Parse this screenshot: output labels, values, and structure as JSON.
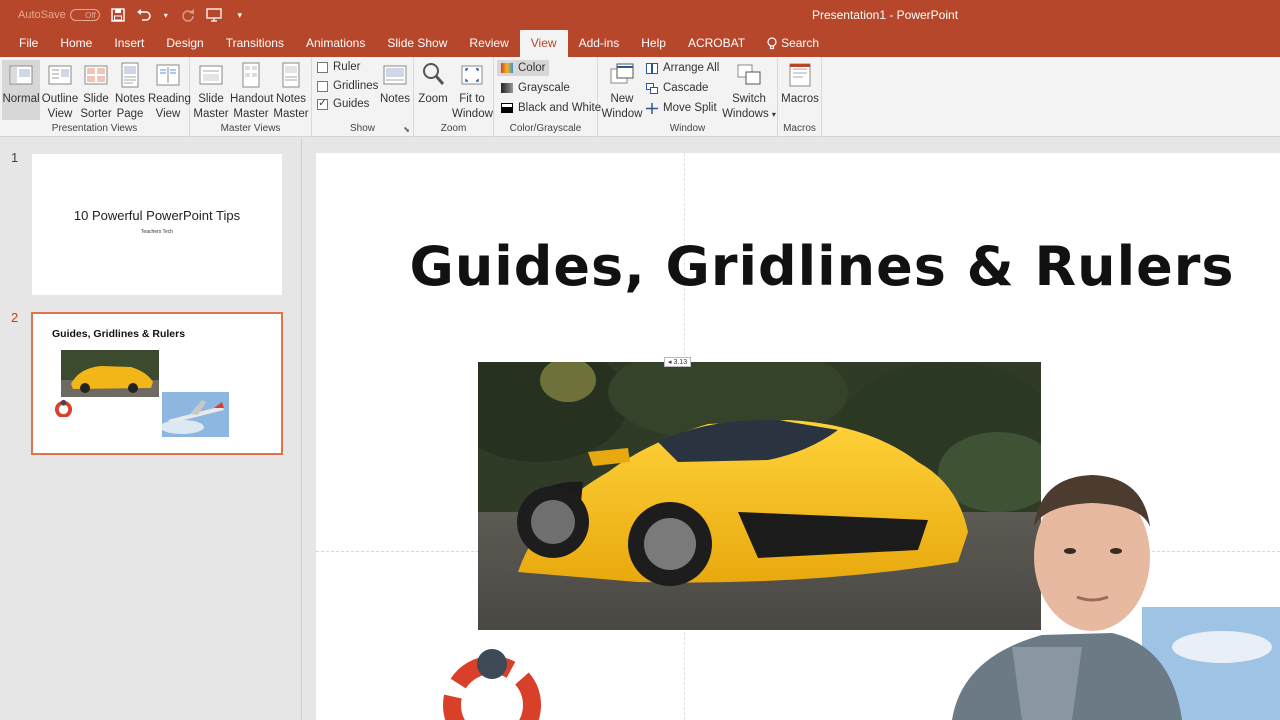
{
  "titlebar": {
    "autosave_label": "AutoSave",
    "autosave_state": "Off",
    "document_title": "Presentation1  -  PowerPoint"
  },
  "tabs": [
    {
      "label": "File"
    },
    {
      "label": "Home"
    },
    {
      "label": "Insert"
    },
    {
      "label": "Design"
    },
    {
      "label": "Transitions"
    },
    {
      "label": "Animations"
    },
    {
      "label": "Slide Show"
    },
    {
      "label": "Review"
    },
    {
      "label": "View"
    },
    {
      "label": "Add-ins"
    },
    {
      "label": "Help"
    },
    {
      "label": "ACROBAT"
    }
  ],
  "search_label": "Search",
  "ribbon": {
    "presentation_views": {
      "label": "Presentation Views",
      "normal": "Normal",
      "outline_1": "Outline",
      "outline_2": "View",
      "sorter_1": "Slide",
      "sorter_2": "Sorter",
      "notes_page_1": "Notes",
      "notes_page_2": "Page",
      "reading_1": "Reading",
      "reading_2": "View"
    },
    "master_views": {
      "label": "Master Views",
      "slide_1": "Slide",
      "slide_2": "Master",
      "handout_1": "Handout",
      "handout_2": "Master",
      "notes_1": "Notes",
      "notes_2": "Master"
    },
    "show": {
      "label": "Show",
      "ruler": "Ruler",
      "gridlines": "Gridlines",
      "guides": "Guides",
      "notes": "Notes",
      "ruler_checked": false,
      "gridlines_checked": false,
      "guides_checked": true
    },
    "zoom": {
      "label": "Zoom",
      "zoom": "Zoom",
      "fit_1": "Fit to",
      "fit_2": "Window"
    },
    "color": {
      "label": "Color/Grayscale",
      "color": "Color",
      "grayscale": "Grayscale",
      "bw": "Black and White"
    },
    "window": {
      "label": "Window",
      "new_1": "New",
      "new_2": "Window",
      "arrange_all": "Arrange All",
      "cascade": "Cascade",
      "move_split": "Move Split",
      "switch_1": "Switch",
      "switch_2": "Windows"
    },
    "macros": {
      "label": "Macros",
      "macros": "Macros"
    }
  },
  "slides": [
    {
      "number": "1",
      "title": "10 Powerful PowerPoint Tips",
      "subtitle": "Teachers Tech"
    },
    {
      "number": "2",
      "title": "Guides, Gridlines & Rulers"
    }
  ],
  "current_slide": {
    "title": "Guides, Gridlines & Rulers",
    "guide_tooltip": "◂ 3.13"
  },
  "colors": {
    "accent": "#b7472a",
    "ribbon_bg": "#f3f3f3",
    "car_yellow": "#f2b618",
    "logo_red": "#d9402a"
  }
}
